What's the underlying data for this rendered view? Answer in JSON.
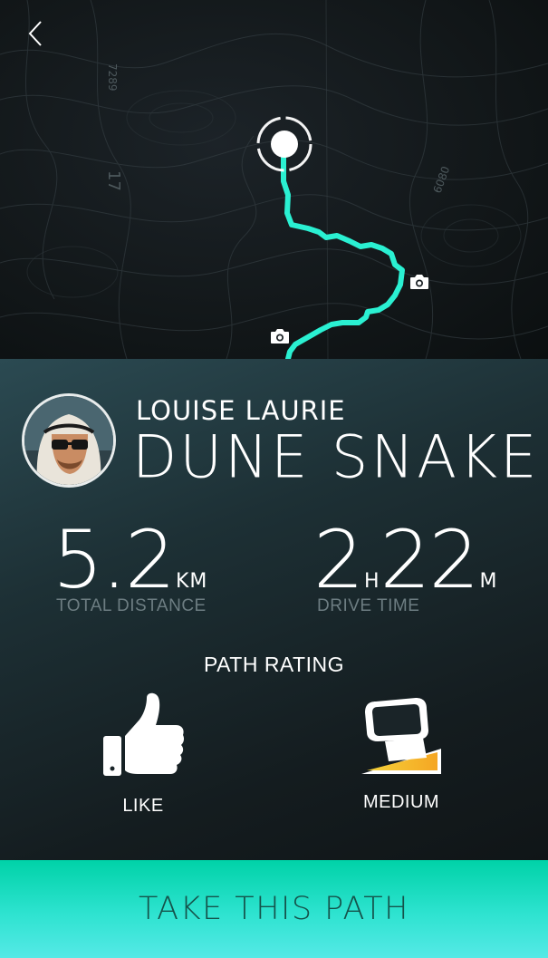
{
  "map": {
    "back_icon": "chevron-left-icon",
    "start_pin_icon": "location-pin-icon",
    "photo_icon": "camera-icon",
    "route_color": "#2af0d2",
    "contour_labels": [
      "17",
      "7289",
      "6080"
    ]
  },
  "profile": {
    "user_name": "LOUISE LAURIE",
    "path_name": "DUNE SNAKE"
  },
  "stats": {
    "distance": {
      "value": "5.2",
      "unit": "KM",
      "label": "TOTAL DISTANCE"
    },
    "drive_time": {
      "hours": "2",
      "hours_unit": "H",
      "minutes": "22",
      "minutes_unit": "M",
      "label": "DRIVE TIME"
    }
  },
  "rating": {
    "heading": "PATH RATING",
    "like": {
      "label": "LIKE",
      "icon": "thumbs-up-icon"
    },
    "difficulty": {
      "label": "MEDIUM",
      "icon": "difficulty-slope-icon",
      "accent": "#f5a623"
    }
  },
  "cta": {
    "label": "TAKE THIS PATH",
    "color": "#00d2a8"
  }
}
